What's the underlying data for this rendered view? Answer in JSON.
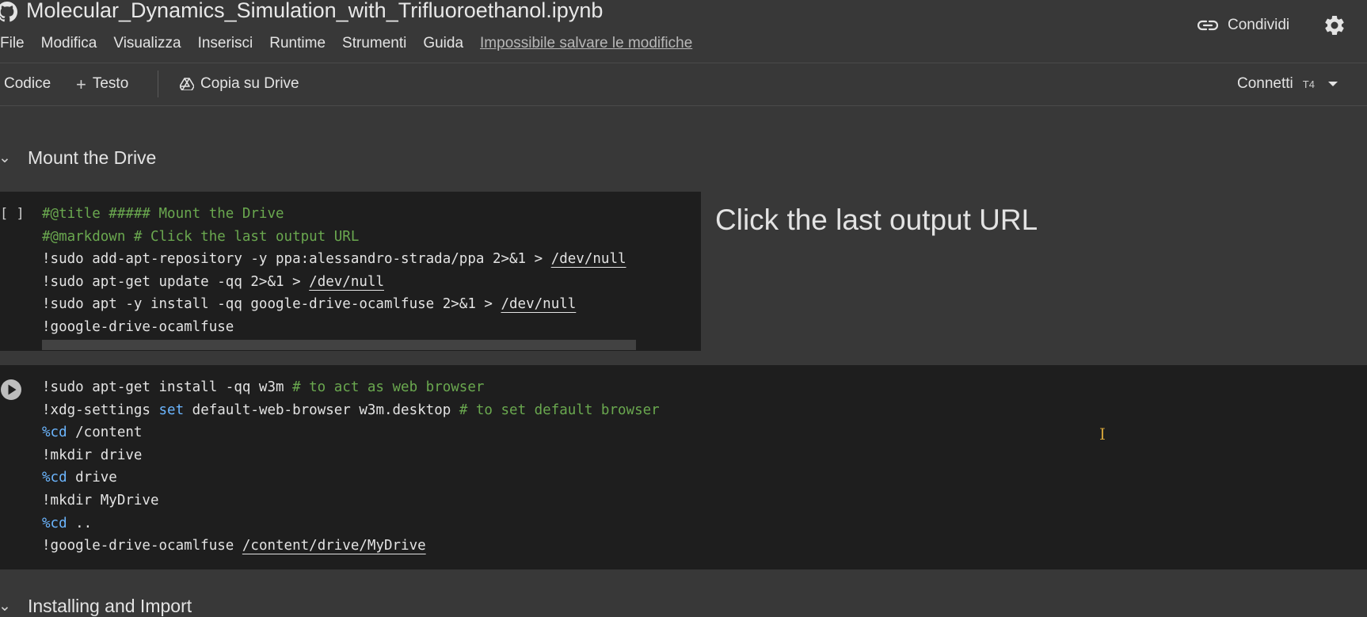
{
  "header": {
    "title": "Molecular_Dynamics_Simulation_with_Trifluoroethanol.ipynb",
    "logo_icon": "github-icon",
    "menu": [
      "File",
      "Modifica",
      "Visualizza",
      "Inserisci",
      "Runtime",
      "Strumenti",
      "Guida"
    ],
    "save_warning": "Impossibile salvare le modifiche",
    "share_label": "Condividi",
    "share_icon": "link-icon",
    "settings_icon": "gear-icon"
  },
  "toolbar": {
    "code_label": "Codice",
    "text_plus": "+",
    "text_label": "Testo",
    "drive_label": "Copia su Drive",
    "connect_label": "Connetti",
    "runtime": "T4"
  },
  "sections": [
    {
      "title": "Mount the Drive"
    },
    {
      "title": "Installing and Import"
    }
  ],
  "cell1": {
    "status": "[ ]",
    "form_title": "Click the last output URL",
    "lines": [
      [
        {
          "t": "#@title ##### Mount the Drive",
          "c": "cm"
        }
      ],
      [
        {
          "t": "#@markdown # Click the last output URL",
          "c": "cm"
        }
      ],
      [
        {
          "t": "!sudo add-apt-repository -y ppa:alessandro-strada/ppa 2>&1 > ",
          "c": ""
        },
        {
          "t": "/dev/null",
          "c": "link"
        }
      ],
      [
        {
          "t": "!sudo apt-get update -qq 2>&1 > ",
          "c": ""
        },
        {
          "t": "/dev/null",
          "c": "link"
        }
      ],
      [
        {
          "t": "!sudo apt -y install -qq google-drive-ocamlfuse 2>&1 > ",
          "c": ""
        },
        {
          "t": "/dev/null",
          "c": "link"
        }
      ],
      [
        {
          "t": "!google-drive-ocamlfuse",
          "c": ""
        }
      ]
    ]
  },
  "cell2": {
    "lines": [
      [
        {
          "t": "!sudo apt-get install -qq w3m ",
          "c": ""
        },
        {
          "t": "# to act as web browser",
          "c": "cm"
        }
      ],
      [
        {
          "t": "!xdg-settings ",
          "c": ""
        },
        {
          "t": "set",
          "c": "kw"
        },
        {
          "t": " default-web-browser w3m.desktop ",
          "c": ""
        },
        {
          "t": "# to set default browser",
          "c": "cm"
        }
      ],
      [
        {
          "t": "%cd",
          "c": "kw"
        },
        {
          "t": " /content",
          "c": ""
        }
      ],
      [
        {
          "t": "!mkdir drive",
          "c": ""
        }
      ],
      [
        {
          "t": "%cd",
          "c": "kw"
        },
        {
          "t": " drive",
          "c": ""
        }
      ],
      [
        {
          "t": "!mkdir MyDrive",
          "c": ""
        }
      ],
      [
        {
          "t": "%cd",
          "c": "kw"
        },
        {
          "t": " ..",
          "c": ""
        }
      ],
      [
        {
          "t": "!google-drive-ocamlfuse ",
          "c": ""
        },
        {
          "t": "/content/drive/MyDrive",
          "c": "link"
        }
      ]
    ]
  },
  "colors": {
    "background": "#383838",
    "cell_background": "#1e1e1e",
    "comment": "#6aa84f",
    "keyword": "#6cb6ff",
    "cursor": "#d1a23a"
  }
}
